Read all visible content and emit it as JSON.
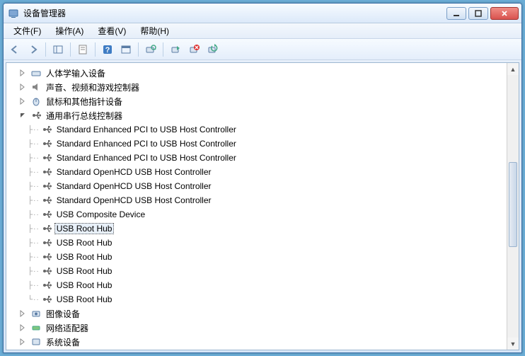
{
  "title": "设备管理器",
  "menu": {
    "file": "文件(F)",
    "action": "操作(A)",
    "view": "查看(V)",
    "help": "帮助(H)"
  },
  "tree": {
    "hid": {
      "label": "人体学输入设备",
      "expanded": false
    },
    "sound": {
      "label": "声音、视频和游戏控制器",
      "expanded": false
    },
    "mouse": {
      "label": "鼠标和其他指针设备",
      "expanded": false
    },
    "usb": {
      "label": "通用串行总线控制器",
      "expanded": true,
      "children": [
        "Standard Enhanced PCI to USB Host Controller",
        "Standard Enhanced PCI to USB Host Controller",
        "Standard Enhanced PCI to USB Host Controller",
        "Standard OpenHCD USB Host Controller",
        "Standard OpenHCD USB Host Controller",
        "Standard OpenHCD USB Host Controller",
        "USB Composite Device",
        "USB Root Hub",
        "USB Root Hub",
        "USB Root Hub",
        "USB Root Hub",
        "USB Root Hub",
        "USB Root Hub"
      ],
      "selected_index": 7
    },
    "imaging": {
      "label": "图像设备",
      "expanded": false
    },
    "network": {
      "label": "网络适配器",
      "expanded": false
    },
    "system": {
      "label": "系统设备",
      "expanded": false
    }
  }
}
